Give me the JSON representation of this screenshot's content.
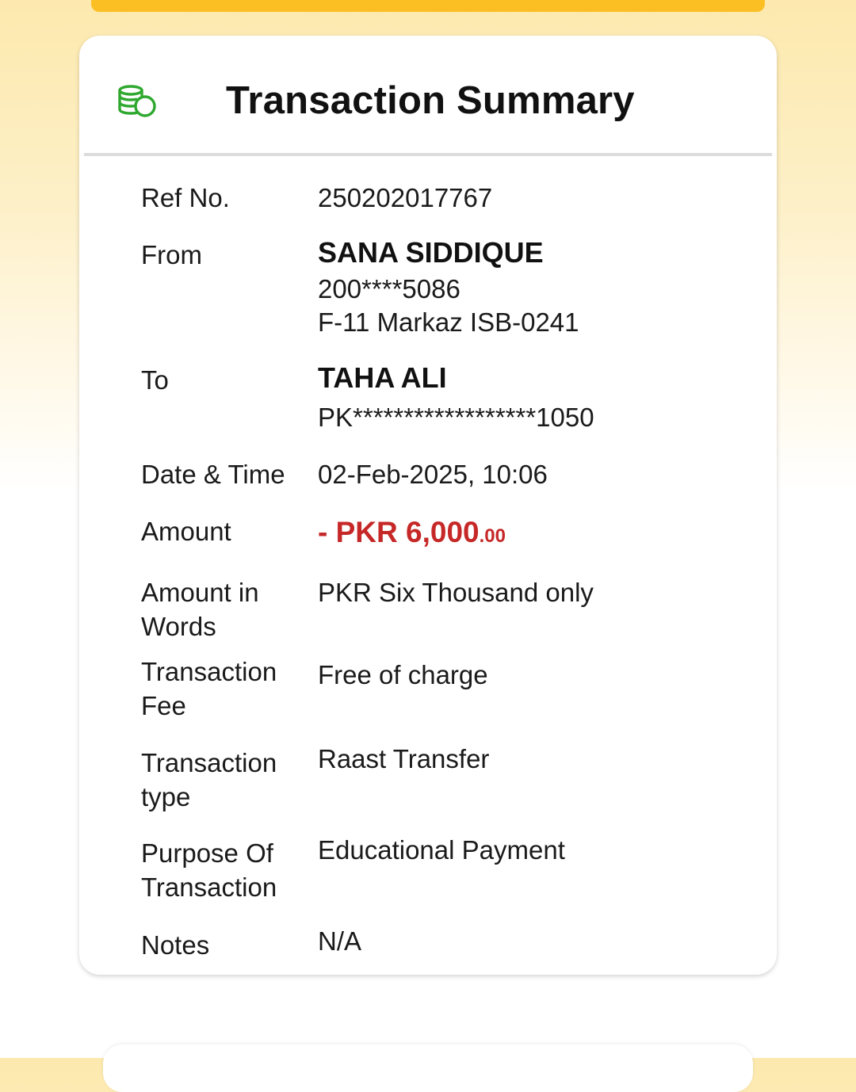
{
  "summary": {
    "title": "Transaction Summary",
    "icon": "coins-icon",
    "accent_color": "#2ea82e",
    "amount_color": "#c62828",
    "rows": {
      "ref_no": {
        "label": "Ref No.",
        "value": "250202017767"
      },
      "from": {
        "label": "From",
        "name": "SANA SIDDIQUE",
        "account": "200****5086",
        "branch": "F-11 Markaz ISB-0241"
      },
      "to": {
        "label": "To",
        "name": "TAHA ALI",
        "account": "PK******************1050"
      },
      "date_time": {
        "label": "Date & Time",
        "value": "02-Feb-2025, 10:06"
      },
      "amount": {
        "label": "Amount",
        "prefix": "- ",
        "value": "PKR 6,000",
        "cents": ".00"
      },
      "amount_words": {
        "label_line1": "Amount in",
        "label_line2": "Words",
        "value": "PKR Six Thousand only"
      },
      "fee": {
        "label_line1": "Transaction",
        "label_line2": "Fee",
        "value": "Free of charge"
      },
      "type": {
        "label_line1": "Transaction",
        "label_line2": "type",
        "value": "Raast Transfer"
      },
      "purpose": {
        "label_line1": "Purpose Of",
        "label_line2": "Transaction",
        "value": "Educational Payment"
      },
      "notes": {
        "label": "Notes",
        "value": "N/A"
      }
    }
  }
}
